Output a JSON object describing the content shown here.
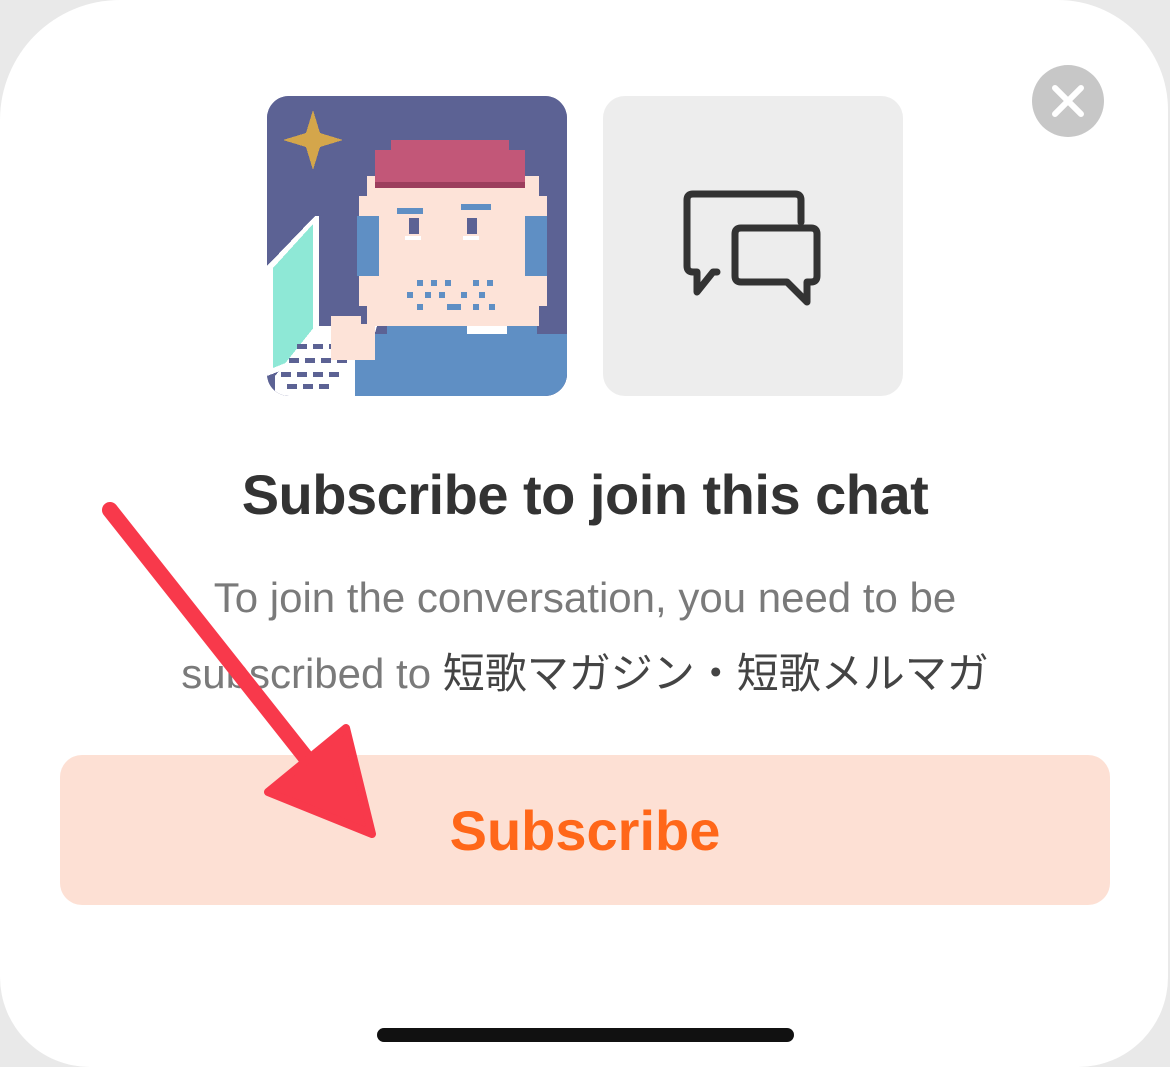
{
  "dialog": {
    "title": "Subscribe to join this chat",
    "description_prefix": "To join the conversation, you need to be subscribed to ",
    "publication_name": "短歌マガジン・短歌メルマガ",
    "subscribe_label": "Subscribe"
  },
  "icons": {
    "close": "close-icon",
    "chat": "chat-bubbles-icon",
    "annotation": "red-arrow-annotation"
  },
  "colors": {
    "accent": "#ff6719",
    "button_bg": "#fde0d4",
    "annotation_arrow": "#f8394b"
  }
}
